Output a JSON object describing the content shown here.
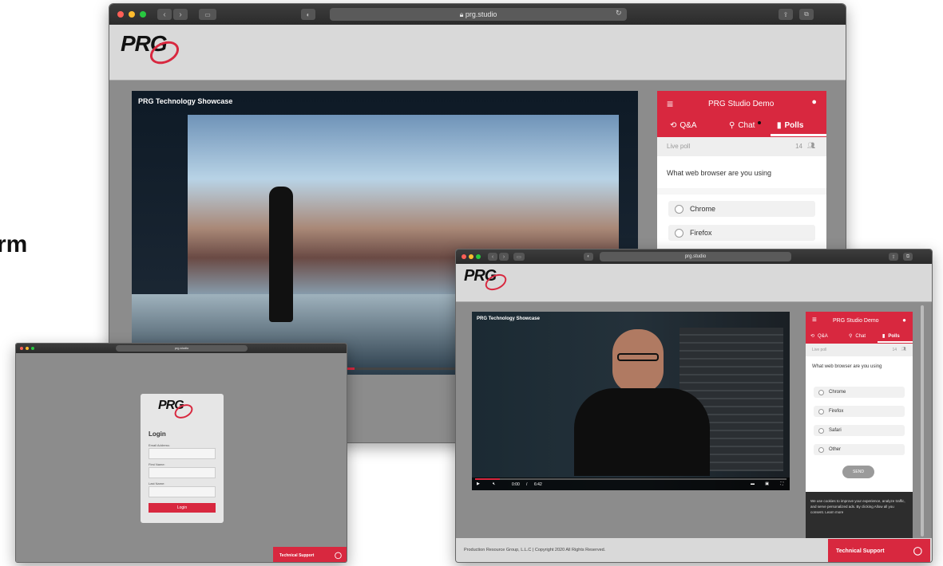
{
  "side_text": "rm",
  "main_window": {
    "url": "prg.studio",
    "logo": "PRG",
    "video_title": "PRG Technology Showcase",
    "panel": {
      "title": "PRG Studio Demo",
      "tabs": [
        "Q&A",
        "Chat",
        "Polls"
      ],
      "live_poll_label": "Live poll",
      "participants": "14",
      "question": "What web browser are you using",
      "options": [
        "Chrome",
        "Firefox"
      ]
    }
  },
  "second_window": {
    "url": "prg.studio",
    "logo": "PRG",
    "video_title": "PRG Technology Showcase",
    "controls": {
      "time_current": "0:00",
      "time_sep": "/",
      "time_total": "6:42"
    },
    "panel": {
      "title": "PRG Studio Demo",
      "tabs": [
        "Q&A",
        "Chat",
        "Polls"
      ],
      "live_poll_label": "Live poll",
      "participants": "14",
      "question": "What web browser are you using",
      "options": [
        "Chrome",
        "Firefox",
        "Safari",
        "Other"
      ],
      "send_label": "SEND",
      "cookie_text": "We use cookies to improve your experience, analyze traffic, and serve personalized ads. By clicking Allow all you consent. Learn more"
    },
    "footer": "Production Resource Group, L.L.C | Copyright 2020 All Rights Reserved.",
    "tech_support": "Technical Support"
  },
  "login_window": {
    "url": "prg.studio",
    "logo": "PRG",
    "heading": "Login",
    "email_label": "Email Address:",
    "first_name_label": "First Name:",
    "last_name_label": "Last Name:",
    "login_button": "Login",
    "tech_support": "Technical Support"
  },
  "colors": {
    "accent": "#d8283f",
    "chrome": "#333333",
    "content_bg": "#8c8c8c"
  }
}
